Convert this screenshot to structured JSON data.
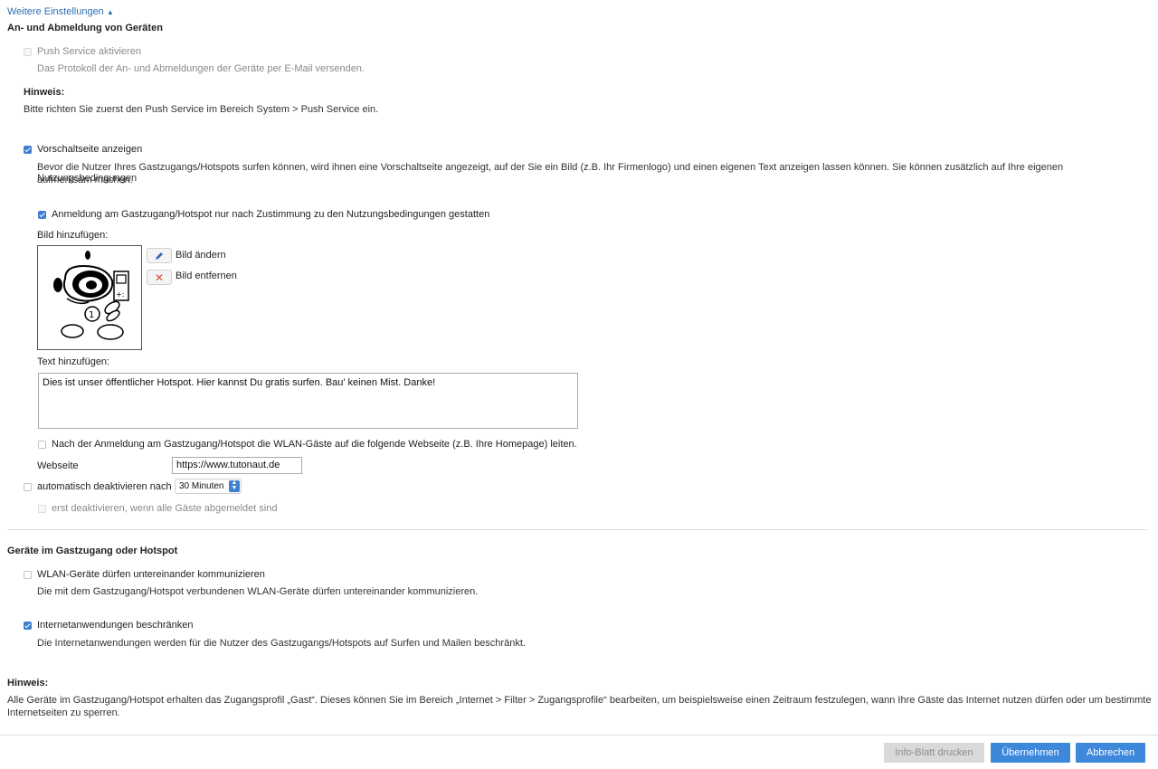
{
  "header": {
    "toggle_label": "Weitere Einstellungen",
    "toggle_arrow": "▲"
  },
  "registration": {
    "heading": "An- und Abmeldung von Geräten",
    "push_label": "Push Service aktivieren",
    "push_desc": "Das Protokoll der An- und Abmeldungen der Geräte per E-Mail versenden.",
    "push_checked": false,
    "hint_heading": "Hinweis:",
    "hint_text": "Bitte richten Sie zuerst den Push Service im Bereich System > Push Service ein."
  },
  "splash": {
    "label": "Vorschaltseite anzeigen",
    "checked": true,
    "desc_line1": "Bevor die Nutzer Ihres Gastzugangs/Hotspots surfen können, wird ihnen eine Vorschaltseite angezeigt, auf der Sie ein Bild (z.B. Ihr Firmenlogo) und einen eigenen Text anzeigen lassen können. Sie können zusätzlich auf Ihre eigenen Nutzungsbedingungen",
    "desc_line2": "aufmerksam machen.",
    "terms_label": "Anmeldung am Gastzugang/Hotspot nur nach Zustimmung zu den Nutzungsbedingungen gestatten",
    "terms_checked": true,
    "image_label": "Bild hinzufügen:",
    "change_image": "Bild ändern",
    "remove_image": "Bild entfernen",
    "text_label": "Text hinzufügen:",
    "text_value": "Dies ist unser öffentlicher Hotspot. Hier kannst Du gratis surfen. Bau' keinen Mist. Danke!",
    "redirect_label": "Nach der Anmeldung am Gastzugang/Hotspot die WLAN-Gäste auf die folgende Webseite (z.B. Ihre Homepage) leiten.",
    "redirect_checked": false,
    "website_label": "Webseite",
    "website_value": "https://www.tutonaut.de",
    "auto_disable_label": "automatisch deaktivieren nach",
    "auto_disable_checked": false,
    "auto_disable_value": "30 Minuten",
    "after_logout_label": "erst deaktivieren, wenn alle Gäste abgemeldet sind",
    "after_logout_checked": false
  },
  "devices": {
    "heading": "Geräte im Gastzugang oder Hotspot",
    "wlan_label": "WLAN-Geräte dürfen untereinander kommunizieren",
    "wlan_checked": false,
    "wlan_desc": "Die mit dem Gastzugang/Hotspot verbundenen WLAN-Geräte dürfen untereinander kommunizieren.",
    "internet_label": "Internetanwendungen beschränken",
    "internet_checked": true,
    "internet_desc": "Die Internetanwendungen werden für die Nutzer des Gastzugangs/Hotspots auf Surfen und Mailen beschränkt."
  },
  "note": {
    "heading": "Hinweis:",
    "line1": "Alle Geräte im Gastzugang/Hotspot erhalten das Zugangsprofil „Gast“. Dieses können Sie im Bereich „Internet > Filter > Zugangsprofile“ bearbeiten, um beispielsweise einen Zeitraum festzulegen, wann Ihre Gäste das Internet nutzen dürfen oder um bestimmte",
    "line2": "Internetseiten zu sperren."
  },
  "footer": {
    "print_label": "Info-Blatt drucken",
    "apply_label": "Übernehmen",
    "cancel_label": "Abbrechen"
  },
  "colors": {
    "link": "#2f6db5",
    "primary": "#3e88dc",
    "checkbox": "#3e7fd1"
  }
}
